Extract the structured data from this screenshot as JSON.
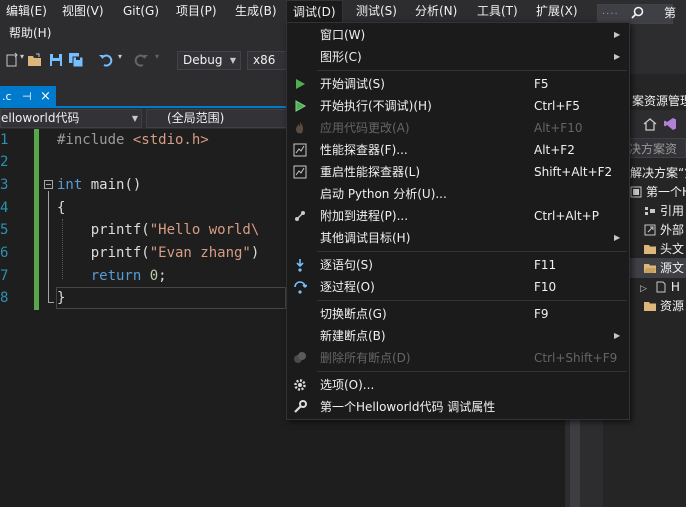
{
  "menubar": {
    "items": [
      "编辑(E)",
      "视图(V)",
      "Git(G)",
      "项目(P)",
      "生成(B)",
      "调试(D)",
      "测试(S)",
      "分析(N)",
      "工具(T)",
      "扩展(X)"
    ],
    "help": "帮助(H)",
    "search_placeholder": "....",
    "brand": "第"
  },
  "toolbar": {
    "config": "Debug",
    "platform": "x86"
  },
  "tab": {
    "title": ".c",
    "pin": "⊣",
    "close": "×"
  },
  "nav": {
    "project": "elloworld代码",
    "scope": "(全局范围)"
  },
  "editor": {
    "line_numbers": [
      "1",
      "2",
      "3",
      "4",
      "5",
      "6",
      "7",
      "8"
    ],
    "lines": {
      "l1_pp": "#include ",
      "l1_str": "<stdio.h>",
      "l3_kw": "int",
      "l3_rest": " main()",
      "l4": "{",
      "l5_fn": "    printf(",
      "l5_str": "\"Hello world\\",
      "l6_fn": "    printf(",
      "l6_str": "\"Evan zhang\"",
      "l6_rest": ")",
      "l7_kw": "    return",
      "l7_num": " 0",
      "l7_rest": ";",
      "l8": "}"
    }
  },
  "solution_explorer": {
    "title": "案资源管理",
    "search": "决方案资",
    "items": [
      "解决方案“第",
      "第一个H",
      "引用",
      "外部",
      "头文",
      "源文",
      "H",
      "资源"
    ]
  },
  "debug_menu": {
    "items": [
      {
        "label": "窗口(W)",
        "shortcut": "",
        "submenu": true,
        "disabled": false,
        "icon": ""
      },
      {
        "label": "图形(C)",
        "shortcut": "",
        "submenu": true,
        "disabled": false,
        "icon": ""
      },
      {
        "label": "开始调试(S)",
        "shortcut": "F5",
        "submenu": false,
        "disabled": false,
        "icon": "play-icon"
      },
      {
        "label": "开始执行(不调试)(H)",
        "shortcut": "Ctrl+F5",
        "submenu": false,
        "disabled": false,
        "icon": "play-outline-icon"
      },
      {
        "label": "应用代码更改(A)",
        "shortcut": "Alt+F10",
        "submenu": false,
        "disabled": true,
        "icon": "flame-icon"
      },
      {
        "label": "性能探查器(F)...",
        "shortcut": "Alt+F2",
        "submenu": false,
        "disabled": false,
        "icon": "performance-icon"
      },
      {
        "label": "重启性能探查器(L)",
        "shortcut": "Shift+Alt+F2",
        "submenu": false,
        "disabled": false,
        "icon": "performance-restart-icon"
      },
      {
        "label": "启动 Python 分析(U)...",
        "shortcut": "",
        "submenu": false,
        "disabled": false,
        "icon": ""
      },
      {
        "label": "附加到进程(P)...",
        "shortcut": "Ctrl+Alt+P",
        "submenu": false,
        "disabled": false,
        "icon": "attach-icon"
      },
      {
        "label": "其他调试目标(H)",
        "shortcut": "",
        "submenu": true,
        "disabled": false,
        "icon": ""
      },
      {
        "label": "逐语句(S)",
        "shortcut": "F11",
        "submenu": false,
        "disabled": false,
        "icon": "step-into-icon"
      },
      {
        "label": "逐过程(O)",
        "shortcut": "F10",
        "submenu": false,
        "disabled": false,
        "icon": "step-over-icon"
      },
      {
        "label": "切换断点(G)",
        "shortcut": "F9",
        "submenu": false,
        "disabled": false,
        "icon": ""
      },
      {
        "label": "新建断点(B)",
        "shortcut": "",
        "submenu": true,
        "disabled": false,
        "icon": ""
      },
      {
        "label": "删除所有断点(D)",
        "shortcut": "Ctrl+Shift+F9",
        "submenu": false,
        "disabled": true,
        "icon": "delete-breakpoints-icon"
      },
      {
        "label": "选项(O)...",
        "shortcut": "",
        "submenu": false,
        "disabled": false,
        "icon": "gear-icon"
      },
      {
        "label": "第一个Helloworld代码 调试属性",
        "shortcut": "",
        "submenu": false,
        "disabled": false,
        "icon": "wrench-icon"
      }
    ]
  },
  "colors": {
    "accent": "#007acc",
    "menu_bg": "#1b1b1c",
    "editor_bg": "#1e1e1e",
    "change_bar": "#57a64a"
  }
}
